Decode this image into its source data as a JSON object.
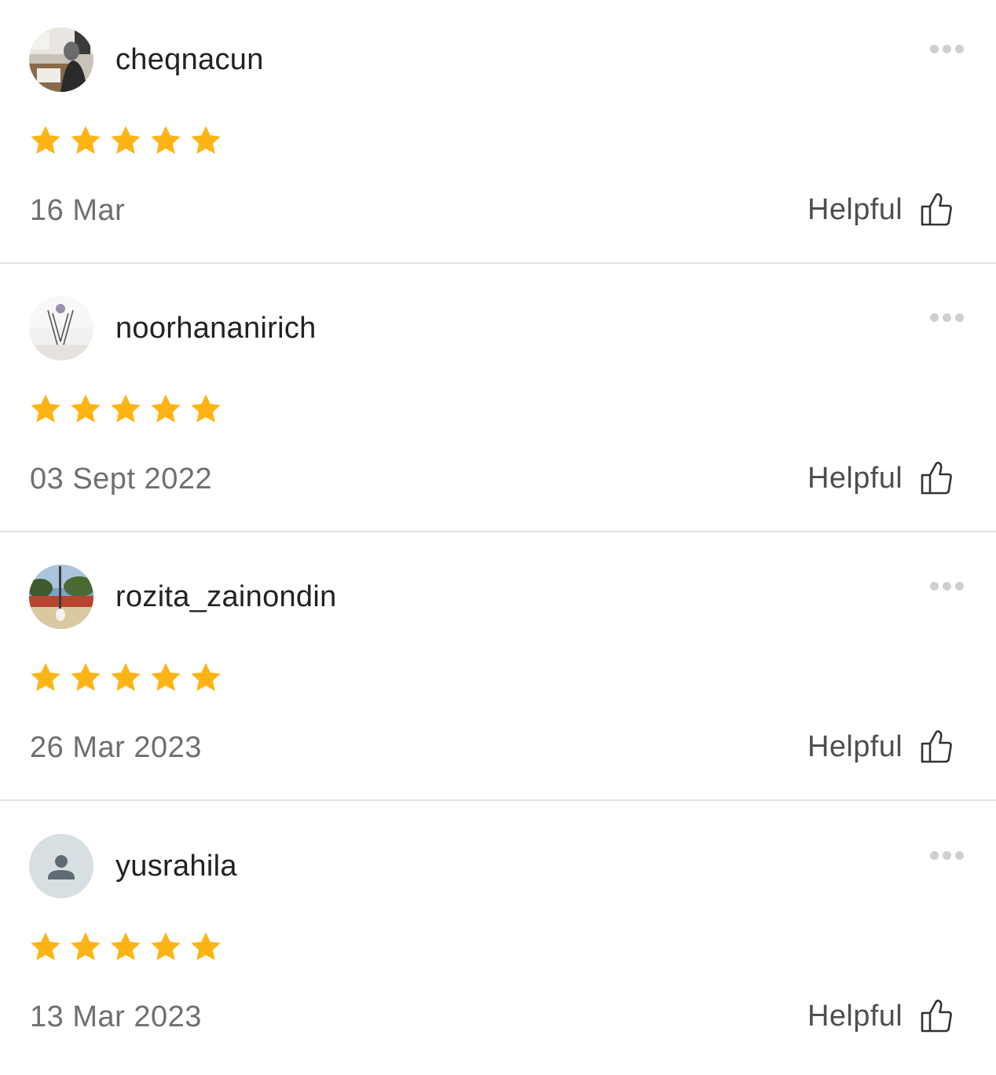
{
  "reviews": [
    {
      "username": "cheqnacun",
      "rating": 5,
      "date": "16 Mar",
      "helpful_label": "Helpful",
      "avatar": "photo"
    },
    {
      "username": "noorhananirich",
      "rating": 5,
      "date": "03 Sept 2022",
      "helpful_label": "Helpful",
      "avatar": "photo"
    },
    {
      "username": "rozita_zainondin",
      "rating": 5,
      "date": "26 Mar 2023",
      "helpful_label": "Helpful",
      "avatar": "photo"
    },
    {
      "username": "yusrahila",
      "rating": 5,
      "date": "13 Mar 2023",
      "helpful_label": "Helpful",
      "avatar": "default-user-icon"
    }
  ],
  "colors": {
    "star": "#FFB415",
    "date_text": "#6F6F6F",
    "helpful_text": "#4F4F4F",
    "divider": "#E2E2E2",
    "more_dots": "#CFCFCF"
  },
  "icons": {
    "more": "more-dots-icon",
    "helpful": "thumbs-up-icon",
    "star": "star-icon"
  }
}
